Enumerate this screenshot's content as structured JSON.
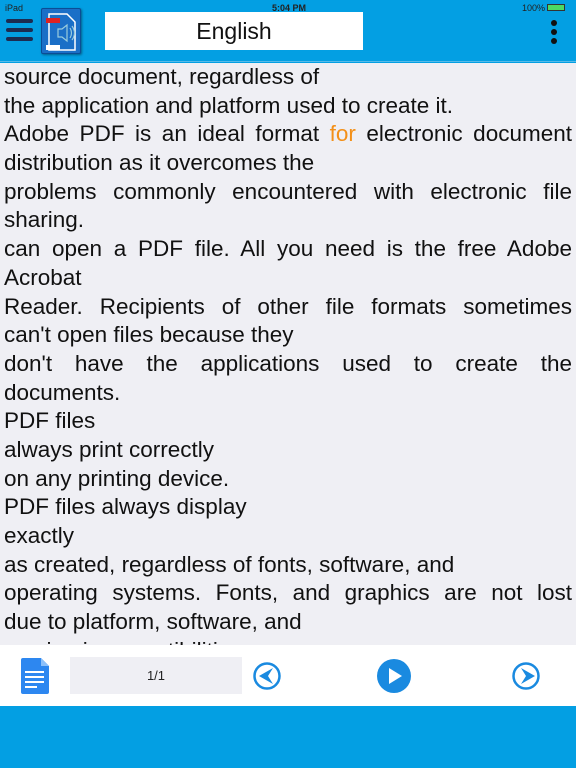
{
  "status": {
    "device": "iPad",
    "time": "5:04 PM",
    "battery": "100%"
  },
  "header": {
    "title": "English"
  },
  "content": {
    "lines": [
      {
        "text": "source document, regardless of",
        "justify": false
      },
      {
        "text": "the application and platform used to create it.",
        "justify": false
      },
      {
        "parts": [
          "Adobe PDF is an ideal format ",
          "for",
          " electronic document"
        ],
        "justify": true
      },
      {
        "text": "distribution as it overcomes the",
        "justify": false
      },
      {
        "text": "problems commonly encountered with electronic file",
        "justify": true
      },
      {
        "text": "sharing.",
        "justify": false
      },
      {
        "text": " can open a PDF file. All you need is the free Adobe",
        "justify": true
      },
      {
        "text": "Acrobat",
        "justify": false
      },
      {
        "text": "Reader. Recipients of other file formats sometimes",
        "justify": true
      },
      {
        "text": "can't open files because they",
        "justify": false
      },
      {
        "text": "don't have the applications used to create the",
        "justify": true
      },
      {
        "text": "documents.",
        "justify": false
      },
      {
        "text": "PDF files",
        "justify": false
      },
      {
        "text": "always print correctly",
        "justify": false
      },
      {
        "text": " on any printing device.",
        "justify": false
      },
      {
        "text": "PDF files always display",
        "justify": false
      },
      {
        "text": "exactly",
        "justify": false
      },
      {
        "text": " as created, regardless of fonts, software, and",
        "justify": false
      },
      {
        "text": "operating systems. Fonts, and graphics are not lost",
        "justify": true
      },
      {
        "text": "due to platform, software, and",
        "justify": false
      },
      {
        "text": "version incompatibilities.",
        "justify": false
      }
    ],
    "highlight_color": "#f39019"
  },
  "footer": {
    "page_indicator": "1/1"
  },
  "colors": {
    "accent": "#039fe3",
    "button": "#1a8ae0"
  }
}
